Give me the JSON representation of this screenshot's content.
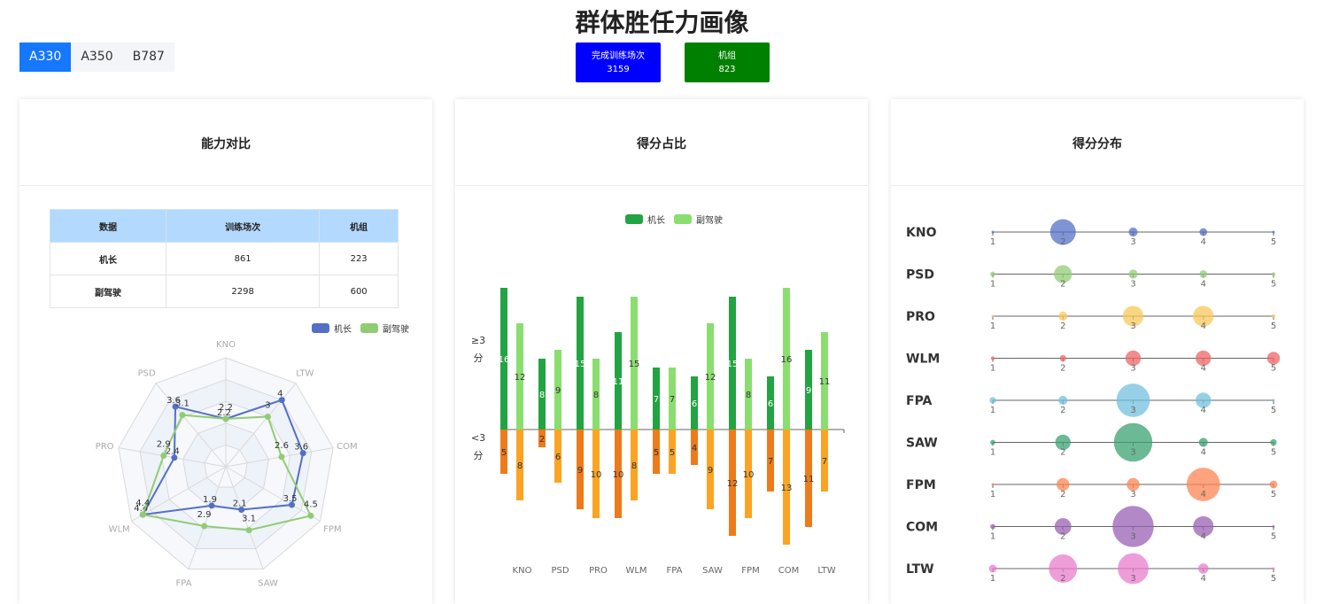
{
  "page": {
    "title": "群体胜任力画像"
  },
  "tabs": [
    {
      "label": "A330",
      "active": true
    },
    {
      "label": "A350",
      "active": false
    },
    {
      "label": "B787",
      "active": false
    }
  ],
  "stats": [
    {
      "label": "完成训练场次",
      "value": "3159",
      "color": "#0000ff"
    },
    {
      "label": "机组",
      "value": "823",
      "color": "#008000"
    }
  ],
  "panels": {
    "ability": {
      "title": "能力对比"
    },
    "ratio": {
      "title": "得分占比"
    },
    "distribution": {
      "title": "得分分布"
    }
  },
  "table": {
    "headers": [
      "数据",
      "训练场次",
      "机组"
    ],
    "rows": [
      {
        "name": "机长",
        "sessions": "861",
        "crews": "223"
      },
      {
        "name": "副驾驶",
        "sessions": "2298",
        "crews": "600"
      }
    ]
  },
  "chart_data": [
    {
      "type": "radar",
      "indicators": [
        "KNO",
        "LTW",
        "COM",
        "FPM",
        "SAW",
        "FPA",
        "WLM",
        "PRO",
        "PSD"
      ],
      "max": 5,
      "legend_position": "top-right",
      "series": [
        {
          "name": "机长",
          "color": "#5470c6",
          "values": [
            2.2,
            4,
            3.6,
            3.5,
            2.1,
            1.9,
            4.4,
            2.4,
            3.6
          ]
        },
        {
          "name": "副驾驶",
          "color": "#91cc75",
          "values": [
            2.2,
            3,
            2.6,
            4.5,
            3.1,
            2.9,
            4.4,
            2.9,
            3.1
          ]
        }
      ]
    },
    {
      "type": "bar",
      "categories": [
        "KNO",
        "PSD",
        "PRO",
        "WLM",
        "FPA",
        "SAW",
        "FPM",
        "COM",
        "LTW"
      ],
      "ylabels": [
        "≥3分",
        "<3分"
      ],
      "legend_position": "top",
      "series": [
        {
          "name": "机长",
          "group": "≥3分",
          "color": "#22a442",
          "values": [
            16,
            8,
            15,
            11,
            7,
            6,
            15,
            6,
            9
          ]
        },
        {
          "name": "副驾驶",
          "group": "≥3分",
          "color": "#8ade6f",
          "values": [
            12,
            9,
            8,
            15,
            7,
            12,
            8,
            16,
            11
          ]
        },
        {
          "group": "<3分",
          "color": "#ee7b1b",
          "values": [
            5,
            2,
            9,
            10,
            5,
            4,
            12,
            7,
            11
          ]
        },
        {
          "group": "<3分",
          "color": "#fba423",
          "values": [
            8,
            6,
            10,
            8,
            5,
            9,
            10,
            13,
            7
          ]
        }
      ]
    },
    {
      "type": "scatter",
      "subtype": "bubble",
      "rows": [
        "KNO",
        "PSD",
        "PRO",
        "WLM",
        "FPA",
        "SAW",
        "FPM",
        "COM",
        "LTW"
      ],
      "x_ticks": [
        1,
        2,
        3,
        4,
        5
      ],
      "colors": [
        "#5470c6",
        "#91cc75",
        "#fac858",
        "#ee6666",
        "#73c0de",
        "#3ba272",
        "#fc8452",
        "#9a60b4",
        "#ea7ccc"
      ],
      "sizes": [
        [
          1,
          10,
          3.5,
          3,
          1
        ],
        [
          2,
          7,
          3.5,
          3,
          1.5
        ],
        [
          1,
          3.5,
          8,
          8,
          1.5
        ],
        [
          1.5,
          2.5,
          6,
          6,
          5
        ],
        [
          2.5,
          3.5,
          13,
          6,
          1
        ],
        [
          2,
          6,
          15,
          3.5,
          2.5
        ],
        [
          1,
          5,
          5,
          13,
          3
        ],
        [
          2,
          6.5,
          16,
          8,
          1
        ],
        [
          3,
          11,
          12,
          4,
          1
        ]
      ]
    }
  ]
}
